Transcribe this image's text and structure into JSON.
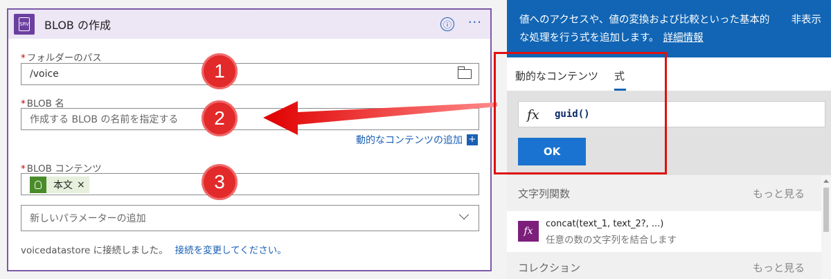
{
  "card": {
    "title": "BLOB の作成",
    "info_icon": "ⓘ",
    "more_icon": "···",
    "badge_text": "SRV"
  },
  "fields": {
    "folder_path": {
      "label": "フォルダーのパス",
      "value": "/voice"
    },
    "blob_name": {
      "label": "BLOB 名",
      "placeholder": "作成する BLOB の名前を指定する"
    },
    "blob_content": {
      "label": "BLOB コンテンツ",
      "token": "本文",
      "token_remove": "×"
    },
    "add_param": {
      "label": "新しいパラメーターの追加"
    }
  },
  "dynamic_content_link": "動的なコンテンツの追加",
  "dynamic_plus": "+",
  "connection": {
    "text": "voicedatastore に接続しました。",
    "link": "接続を変更してください。"
  },
  "annotations": [
    "1",
    "2",
    "3"
  ],
  "panel": {
    "description": "値へのアクセスや、値の変換および比較といった基本的な処理を行う式を追加します。",
    "more_info": "詳細情報",
    "hide": "非表示",
    "tabs": [
      {
        "label": "動的なコンテンツ"
      },
      {
        "label": "式",
        "active": true
      }
    ],
    "fx": "fx",
    "expression": "guid()",
    "ok": "OK",
    "string_functions": {
      "title": "文字列関数",
      "more": "もっと見る"
    },
    "function": {
      "name": "concat(text_1, text_2?, ...)",
      "desc": "任意の数の文字列を結合します"
    },
    "collection": {
      "title": "コレクション",
      "more": "もっと見る"
    }
  },
  "colors": {
    "card_border": "#7b5aa6",
    "panel_blue": "#1165b4",
    "annotation_red": "#e22a2a"
  }
}
